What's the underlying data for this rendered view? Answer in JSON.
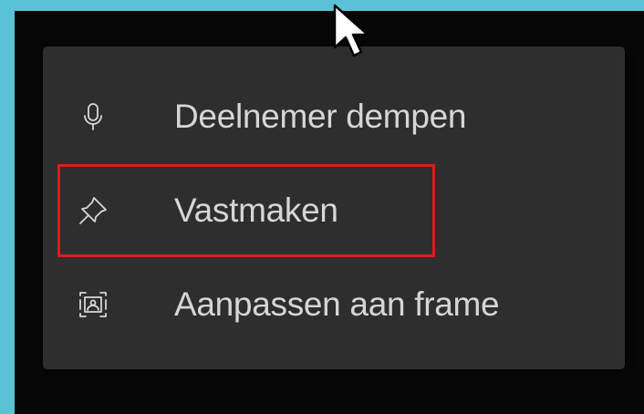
{
  "context_menu": {
    "items": [
      {
        "label": "Deelnemer dempen",
        "icon": "microphone-icon"
      },
      {
        "label": "Vastmaken",
        "icon": "pin-icon",
        "highlighted": true
      },
      {
        "label": "Aanpassen aan frame",
        "icon": "fit-to-frame-icon"
      }
    ]
  },
  "colors": {
    "background": "#5BC2D6",
    "backdrop": "#070707",
    "menu_background": "#2E2E2E",
    "text": "#D6D6D6",
    "highlight_border": "#E11B1B"
  }
}
